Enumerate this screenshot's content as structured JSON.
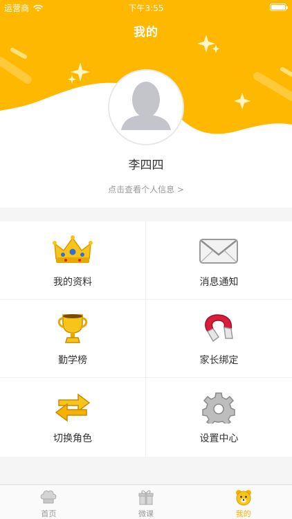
{
  "status": {
    "carrier": "运营商",
    "time": "下午3:55",
    "battery_level": 1.0
  },
  "header": {
    "title": "我的"
  },
  "profile": {
    "name": "李四四",
    "view_info_link": "点击查看个人信息 >"
  },
  "grid": {
    "items": [
      {
        "label": "我的资料",
        "icon": "crown-icon"
      },
      {
        "label": "消息通知",
        "icon": "envelope-icon"
      },
      {
        "label": "勤学榜",
        "icon": "trophy-icon"
      },
      {
        "label": "家长绑定",
        "icon": "magnet-icon"
      },
      {
        "label": "切换角色",
        "icon": "switch-arrows-icon"
      },
      {
        "label": "设置中心",
        "icon": "gear-icon"
      }
    ]
  },
  "tabbar": {
    "tabs": [
      {
        "label": "首页",
        "icon": "chef-hat-icon",
        "active": false
      },
      {
        "label": "微课",
        "icon": "gift-box-icon",
        "active": false
      },
      {
        "label": "我的",
        "icon": "bear-icon",
        "active": true
      }
    ]
  },
  "colors": {
    "accent": "#FFB800",
    "active_tab": "#F5B300",
    "text": "#333333",
    "muted": "#999999"
  }
}
